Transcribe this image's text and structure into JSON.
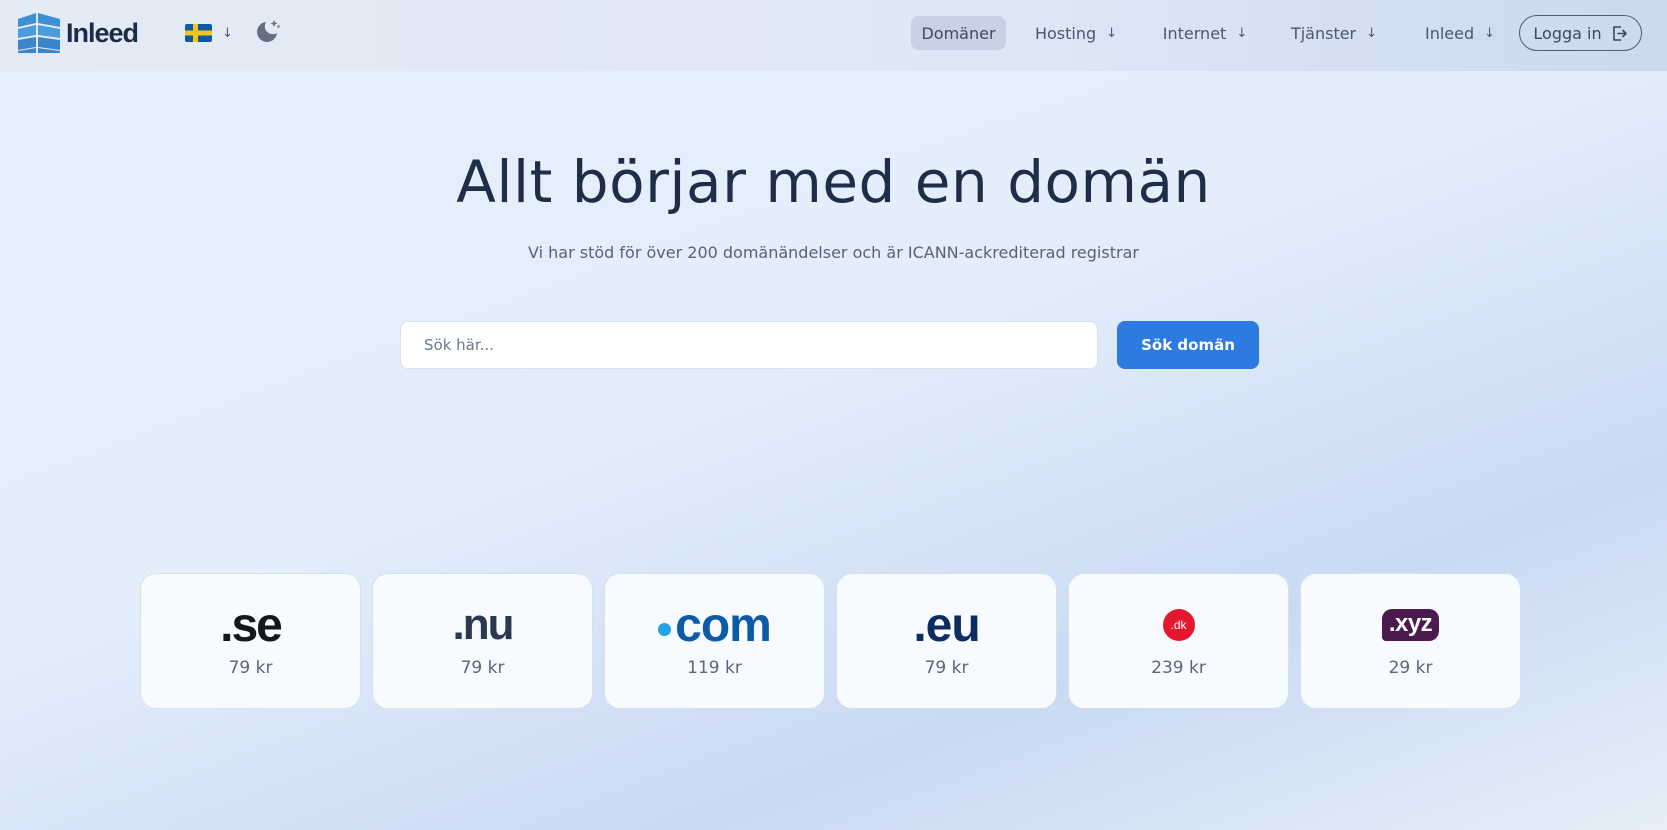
{
  "header": {
    "logo_text": "Inleed",
    "language_flag": "swedish-flag-icon",
    "nav": [
      {
        "label": "Domäner",
        "active": true
      },
      {
        "label": "Hosting",
        "arrow": "↓"
      },
      {
        "label": "Internet",
        "arrow": "↓"
      },
      {
        "label": "Tjänster",
        "arrow": "↓"
      },
      {
        "label": "Inleed",
        "arrow": "↓"
      }
    ],
    "lang_arrow": "↓",
    "login_label": "Logga in"
  },
  "hero": {
    "title": "Allt börjar med en domän",
    "subtitle": "Vi har stöd för över 200 domänändelser och är ICANN-ackrediterad registrar",
    "search_placeholder": "Sök här...",
    "search_button": "Sök domän"
  },
  "tlds": [
    {
      "name": ".se",
      "price": "79 kr"
    },
    {
      "name": ".nu",
      "price": "79 kr"
    },
    {
      "name": "com",
      "price": "119 kr"
    },
    {
      "name": ".eu",
      "price": "79 kr"
    },
    {
      "name": ".dk",
      "price": "239 kr"
    },
    {
      "name": ".xyz",
      "price": "29 kr"
    }
  ],
  "colors": {
    "accent": "#2d7be0",
    "text_dark": "#1e2d48",
    "nav_active_bg": "#c8d1e6"
  }
}
